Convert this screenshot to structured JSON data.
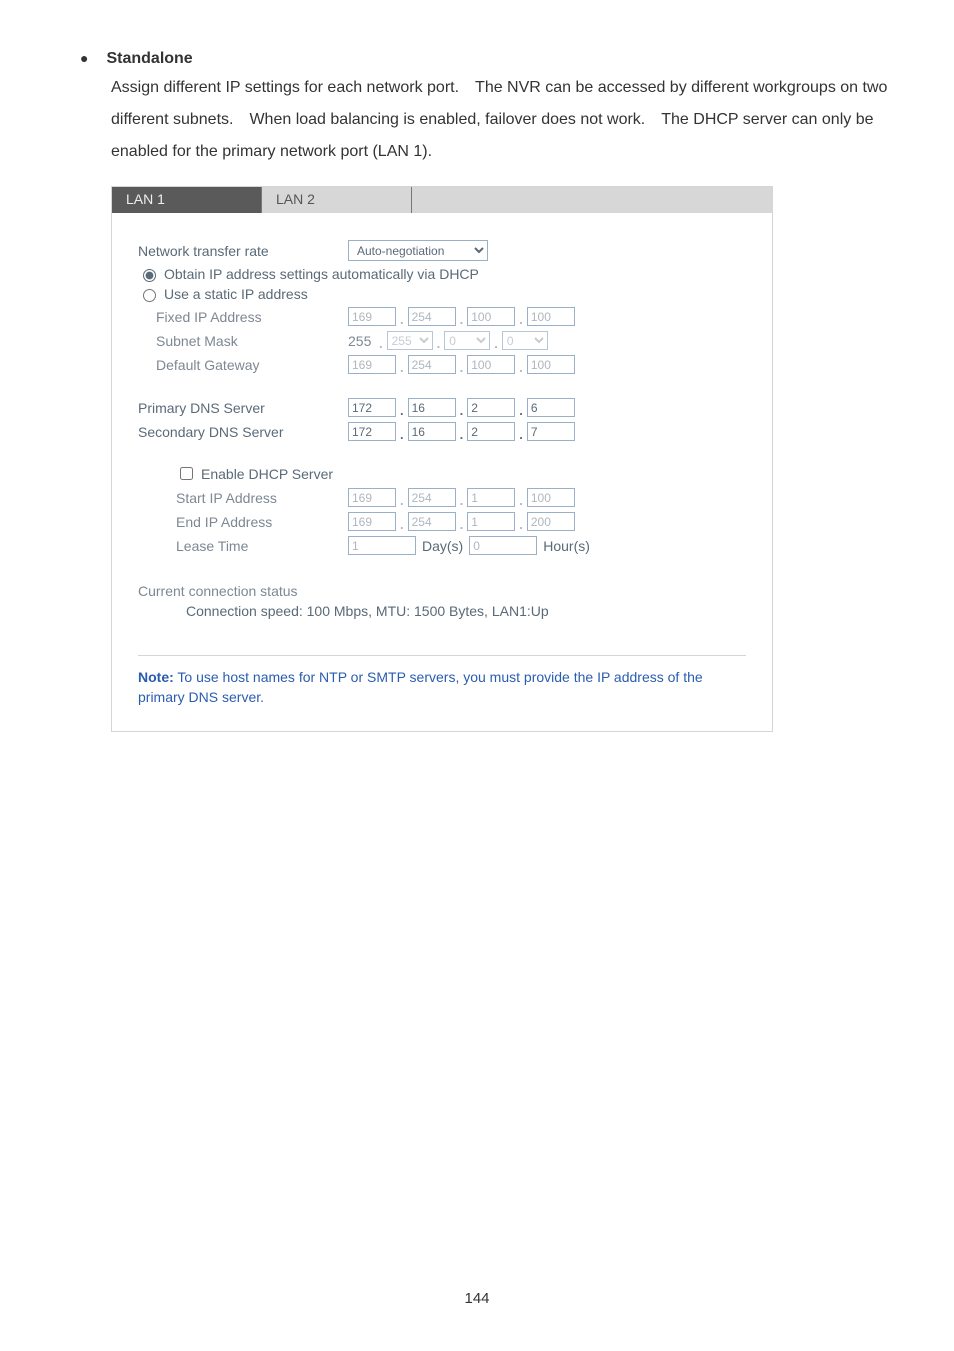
{
  "doc": {
    "heading": "Standalone",
    "paragraph": "Assign different IP settings for each network port. The NVR can be accessed by different workgroups on two different subnets. When load balancing is enabled, failover does not work. The DHCP server can only be enabled for the primary network port (LAN 1).",
    "page_number": "144"
  },
  "tabs": {
    "lan1": "LAN 1",
    "lan2": "LAN 2"
  },
  "form": {
    "transfer_rate_label": "Network transfer rate",
    "transfer_rate_value": "Auto-negotiation",
    "radio_dhcp": "Obtain IP address settings automatically via DHCP",
    "radio_static": "Use a static IP address",
    "fixed_ip_label": "Fixed IP Address",
    "fixed_ip": [
      "169",
      "254",
      "100",
      "100"
    ],
    "subnet_label": "Subnet Mask",
    "subnet_first": "255",
    "subnet": [
      "255",
      "0",
      "0"
    ],
    "gateway_label": "Default Gateway",
    "gateway": [
      "169",
      "254",
      "100",
      "100"
    ],
    "primary_dns_label": "Primary DNS Server",
    "primary_dns": [
      "172",
      "16",
      "2",
      "6"
    ],
    "secondary_dns_label": "Secondary DNS Server",
    "secondary_dns": [
      "172",
      "16",
      "2",
      "7"
    ],
    "dhcp_enable": "Enable DHCP Server",
    "start_ip_label": "Start IP Address",
    "start_ip": [
      "169",
      "254",
      "1",
      "100"
    ],
    "end_ip_label": "End IP Address",
    "end_ip": [
      "169",
      "254",
      "1",
      "200"
    ],
    "lease_label": "Lease Time",
    "lease_days": "1",
    "lease_days_unit": "Day(s)",
    "lease_hours": "0",
    "lease_hours_unit": "Hour(s)",
    "status_title": "Current connection status",
    "status_text": "Connection speed: 100 Mbps, MTU: 1500 Bytes, LAN1:Up",
    "note_bold": "Note:",
    "note_rest": " To use host names for NTP or SMTP servers, you must provide the IP address of the primary DNS server."
  }
}
